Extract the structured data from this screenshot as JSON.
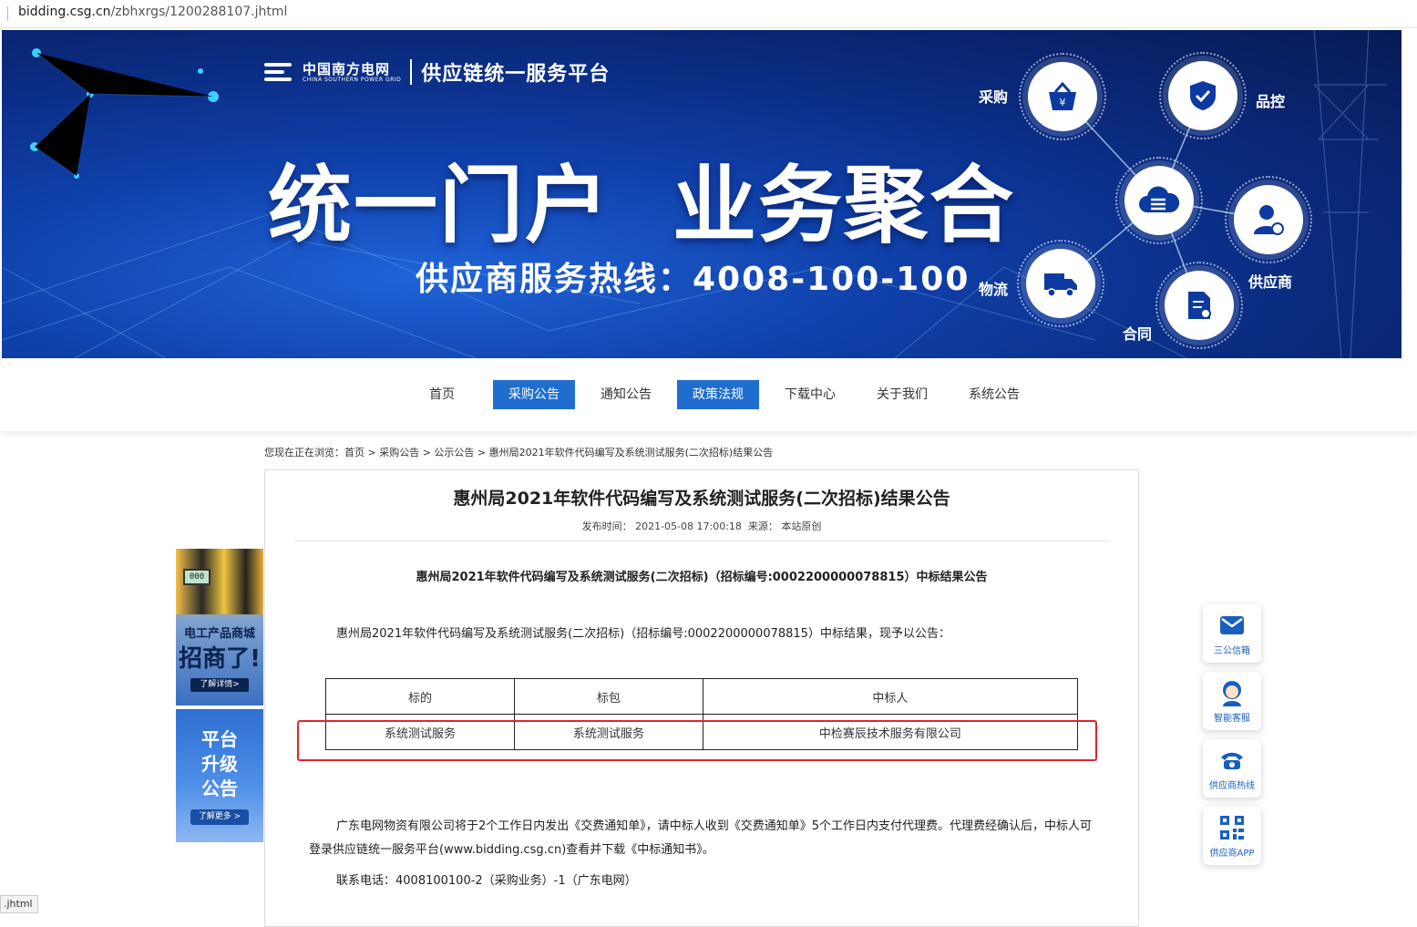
{
  "browser": {
    "url_host": "bidding.csg.cn",
    "url_path": "/zbhxrgs/1200288107.jhtml"
  },
  "banner": {
    "brand_cn": "中国南方电网",
    "brand_en": "CHINA SOUTHERN POWER GRID",
    "platform": "供应链统一服务平台",
    "slogan": "统一门户  业务聚合",
    "hotline": "供应商服务热线：4008-100-100",
    "nodes": {
      "purchase": "采购",
      "quality": "品控",
      "supplier": "供应商",
      "contract": "合同",
      "logistics": "物流"
    }
  },
  "nav": {
    "items": [
      {
        "label": "首页",
        "active": false
      },
      {
        "label": "采购公告",
        "active": true
      },
      {
        "label": "通知公告",
        "active": false
      },
      {
        "label": "政策法规",
        "active": true
      },
      {
        "label": "下载中心",
        "active": false
      },
      {
        "label": "关于我们",
        "active": false
      },
      {
        "label": "系统公告",
        "active": false
      }
    ]
  },
  "breadcrumb": "您现在正在浏览：首页 > 采购公告 > 公示公告 > 惠州局2021年软件代码编写及系统测试服务(二次招标)结果公告",
  "article": {
    "title": "惠州局2021年软件代码编写及系统测试服务(二次招标)结果公告",
    "meta": "发布时间： 2021-05-08 17:00:18  来源： 本站原创",
    "subtitle": "惠州局2021年软件代码编写及系统测试服务(二次招标)（招标编号:0002200000078815）中标结果公告",
    "intro": "惠州局2021年软件代码编写及系统测试服务(二次招标)（招标编号:0002200000078815）中标结果，现予以公告：",
    "table": {
      "headers": [
        "标的",
        "标包",
        "中标人"
      ],
      "rows": [
        [
          "系统测试服务",
          "系统测试服务",
          "中检赛辰技术服务有限公司"
        ]
      ]
    },
    "notice": "广东电网物资有限公司将于2个工作日内发出《交费通知单》，请中标人收到《交费通知单》5个工作日内支付代理费。代理费经确认后，中标人可登录供应链统一服务平台(www.bidding.csg.cn)查看并下载《中标通知书》。",
    "contact": "联系电话：4008100100-2（采购业务）-1（广东电网）"
  },
  "ads": {
    "mall_title": "电工产品商城",
    "mall_headline": "招商了!",
    "mall_button": "了解详情>",
    "meter_text": "000",
    "upgrade_title": "平台\n升级\n公告",
    "upgrade_button": "了解更多 >"
  },
  "float": {
    "mailbox": "三公信箱",
    "service": "智能客服",
    "hotline": "供应商热线",
    "app": "供应商APP"
  },
  "status_text": ".jhtml",
  "colors": {
    "nav_active": "#1f6ecf",
    "highlight_box": "#e0262b",
    "float_label": "#1a5fbf"
  }
}
